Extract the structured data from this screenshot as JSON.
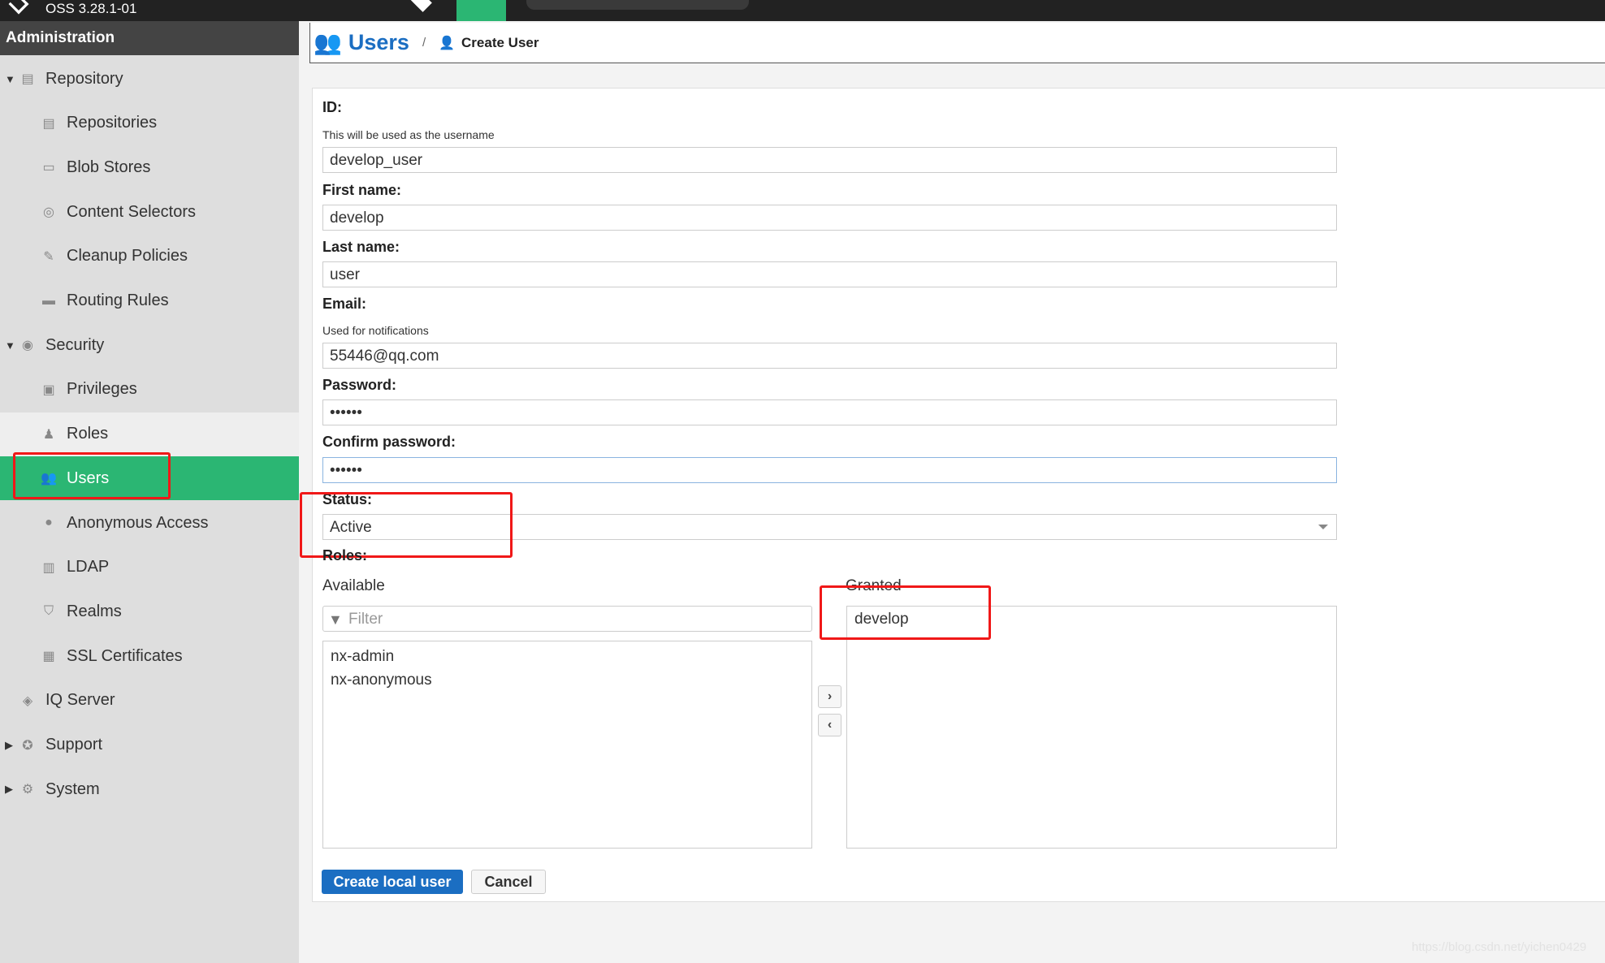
{
  "topbar": {
    "version": "OSS 3.28.1-01"
  },
  "sidebar": {
    "header": "Administration",
    "items": [
      {
        "label": "Repository",
        "level": 1,
        "caret": "▼",
        "icon": "database-icon"
      },
      {
        "label": "Repositories",
        "level": 2,
        "icon": "database-icon"
      },
      {
        "label": "Blob Stores",
        "level": 2,
        "icon": "server-icon"
      },
      {
        "label": "Content Selectors",
        "level": 2,
        "icon": "selector-icon"
      },
      {
        "label": "Cleanup Policies",
        "level": 2,
        "icon": "broom-icon"
      },
      {
        "label": "Routing Rules",
        "level": 2,
        "icon": "router-icon"
      },
      {
        "label": "Security",
        "level": 1,
        "caret": "▼",
        "icon": "eye-icon"
      },
      {
        "label": "Privileges",
        "level": 2,
        "icon": "badge-icon"
      },
      {
        "label": "Roles",
        "level": 2,
        "icon": "role-icon"
      },
      {
        "label": "Users",
        "level": 2,
        "icon": "users-icon"
      },
      {
        "label": "Anonymous Access",
        "level": 2,
        "icon": "person-icon"
      },
      {
        "label": "LDAP",
        "level": 2,
        "icon": "book-icon"
      },
      {
        "label": "Realms",
        "level": 2,
        "icon": "shield-icon"
      },
      {
        "label": "SSL Certificates",
        "level": 2,
        "icon": "certificate-icon"
      },
      {
        "label": "IQ Server",
        "level": 1,
        "icon": "iq-icon"
      },
      {
        "label": "Support",
        "level": 1,
        "caret": "▶",
        "icon": "lifebuoy-icon"
      },
      {
        "label": "System",
        "level": 1,
        "caret": "▶",
        "icon": "gear-icon"
      }
    ]
  },
  "header": {
    "title": "Users",
    "separator": "/",
    "crumb": "Create User"
  },
  "form": {
    "id_label": "ID:",
    "id_hint": "This will be used as the username",
    "id_value": "develop_user",
    "first_label": "First name:",
    "first_value": "develop",
    "last_label": "Last name:",
    "last_value": "user",
    "email_label": "Email:",
    "email_hint": "Used for notifications",
    "email_value": "55446@qq.com",
    "password_label": "Password:",
    "password_value": "••••••",
    "confirm_label": "Confirm password:",
    "confirm_value": "••••••",
    "status_label": "Status:",
    "status_value": "Active",
    "roles_label": "Roles:",
    "available_label": "Available",
    "filter_placeholder": "Filter",
    "available": [
      "nx-admin",
      "nx-anonymous"
    ],
    "granted_label": "Granted",
    "granted": [
      "develop"
    ],
    "create_label": "Create local user",
    "cancel_label": "Cancel"
  },
  "watermark": "https://blog.csdn.net/yichen0429"
}
